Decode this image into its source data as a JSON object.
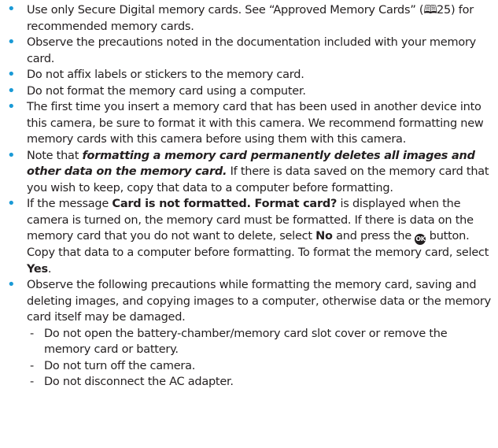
{
  "bullets": {
    "b1": {
      "part1": "Use only Secure Digital memory cards. See “Approved Memory Cards” (",
      "ref_icon": "manual-reference-icon",
      "ref_page": "25",
      "part2": ") for recommended memory cards."
    },
    "b2": {
      "text": "Observe the precautions noted in the documentation included with your memory card."
    },
    "b3": {
      "text": "Do not affix labels or stickers to the memory card."
    },
    "b4": {
      "text": "Do not format the memory card using a computer."
    },
    "b5": {
      "text": "The first time you insert a memory card that has been used in another device into this camera, be sure to format it with this camera. We recommend formatting new memory cards with this camera before using them with this camera."
    },
    "b6": {
      "part1": "Note that ",
      "emphasis": "formatting a memory card permanently deletes all images and other data on the memory card.",
      "part2": " If there is data saved on the memory card that you wish to keep, copy that data to a computer before formatting."
    },
    "b7": {
      "part1": "If the message ",
      "message": "Card is not formatted. Format card?",
      "part2": " is displayed when the camera is turned on, the memory card must be formatted. If there is data on the memory card that you do not want to delete, select ",
      "no_label": "No",
      "part3": " and press the ",
      "ok_glyph": "OK",
      "part4": " button. Copy that data to a computer before formatting. To format the memory card, select ",
      "yes_label": "Yes",
      "part5": "."
    },
    "b8": {
      "text": "Observe the following precautions while formatting the memory card, saving and deleting images, and copying images to a computer, otherwise data or the memory card itself may be damaged.",
      "sub": [
        "Do not open the battery-chamber/memory card slot cover or remove the memory card or battery.",
        "Do not turn off the camera.",
        "Do not disconnect the AC adapter."
      ]
    }
  },
  "colors": {
    "bullet": "#1a9ad6",
    "text": "#231f20"
  }
}
